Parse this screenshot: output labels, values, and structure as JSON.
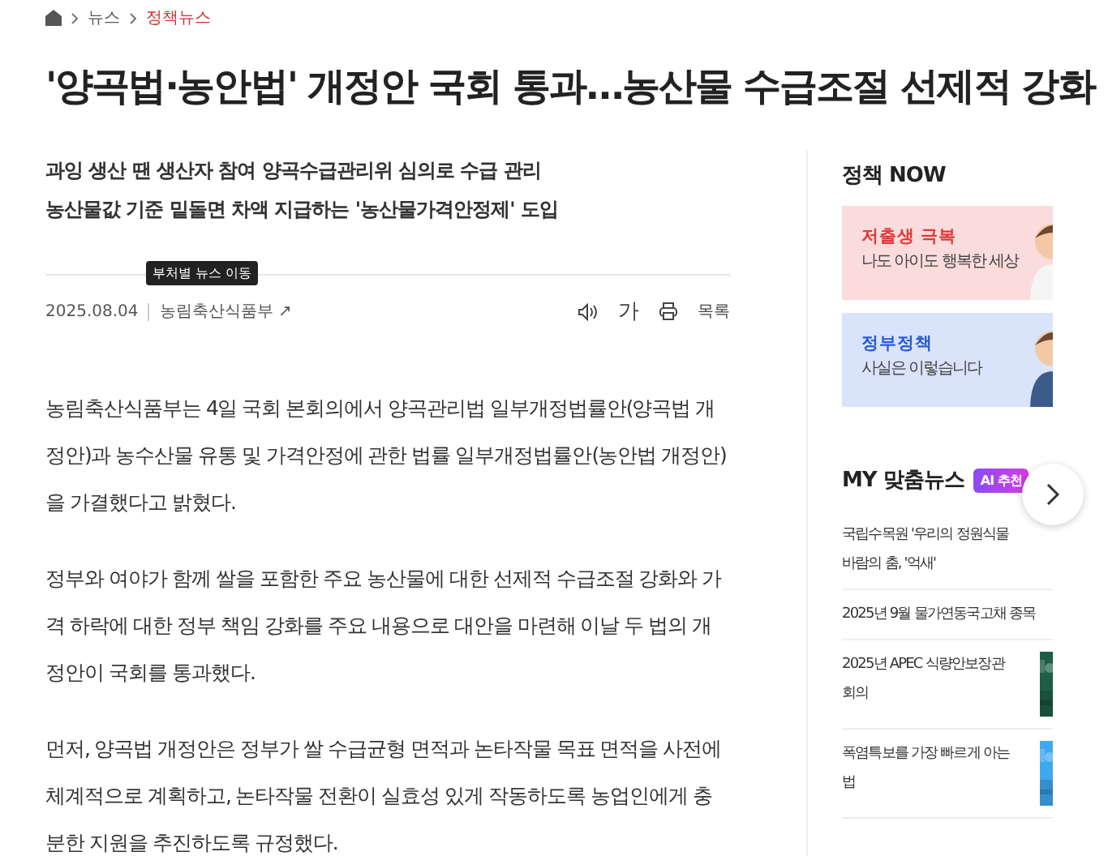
{
  "breadcrumb": [
    {
      "label": "뉴스",
      "current": false
    },
    {
      "label": "정책뉴스",
      "current": true
    }
  ],
  "headline": "'양곡법·농안법' 개정안 국회 통과…농산물 수급조절 선제적 강화",
  "subtitles": [
    "과잉 생산 땐 생산자 참여 양곡수급관리위 심의로 수급 관리",
    "농산물값 기준 밑돌면 차액 지급하는 '농산물가격안정제' 도입"
  ],
  "meta": {
    "date": "2025.08.04",
    "source": "농림축산식품부 ↗",
    "tooltip": "부처별 뉴스 이동",
    "font_button": "가",
    "list_button": "목록"
  },
  "paragraphs": [
    "농림축산식품부는 4일 국회 본회의에서 양곡관리법 일부개정법률안(양곡법 개정안)과 농수산물 유통 및 가격안정에 관한 법률 일부개정법률안(농안법 개정안)을 가결했다고 밝혔다.",
    "정부와 여야가 함께 쌀을 포함한 주요 농산물에 대한 선제적 수급조절 강화와 가격 하락에 대한 정부 책임 강화를 주요 내용으로 대안을 마련해 이날 두 법의 개정안이 국회를 통과했다.",
    "먼저, 양곡법 개정안은 정부가 쌀 수급균형 면적과 논타작물 목표 면적을 사전에 체계적으로 계획하고, 논타작물 전환이 실효성 있게 작동하도록 농업인에게 충분한 지원을 추진하도록 규정했다."
  ],
  "policy_now": {
    "title": "정책 NOW",
    "cards": [
      {
        "kind": "pink",
        "heading": "저출생 극복",
        "text": "나도 아이도 행복한 세상"
      },
      {
        "kind": "blue",
        "heading": "정부정책",
        "text": "사실은 이렇습니다"
      }
    ]
  },
  "my_news": {
    "title": "MY 맞춤뉴스",
    "badge": "AI 추천",
    "items": [
      {
        "lines": [
          "국립수목원 '우리의 정원식물",
          "바람의 춤, '억새'"
        ]
      },
      {
        "lines": [
          "2025년 9월 물가연동국고채 종목"
        ]
      },
      {
        "lines": [
          "2025년 APEC 식량안보장관",
          "회의"
        ],
        "kind": "picture"
      },
      {
        "lines": [
          "폭염특보를 가장 빠르게 아는",
          "법"
        ],
        "kind": "picture"
      }
    ]
  }
}
